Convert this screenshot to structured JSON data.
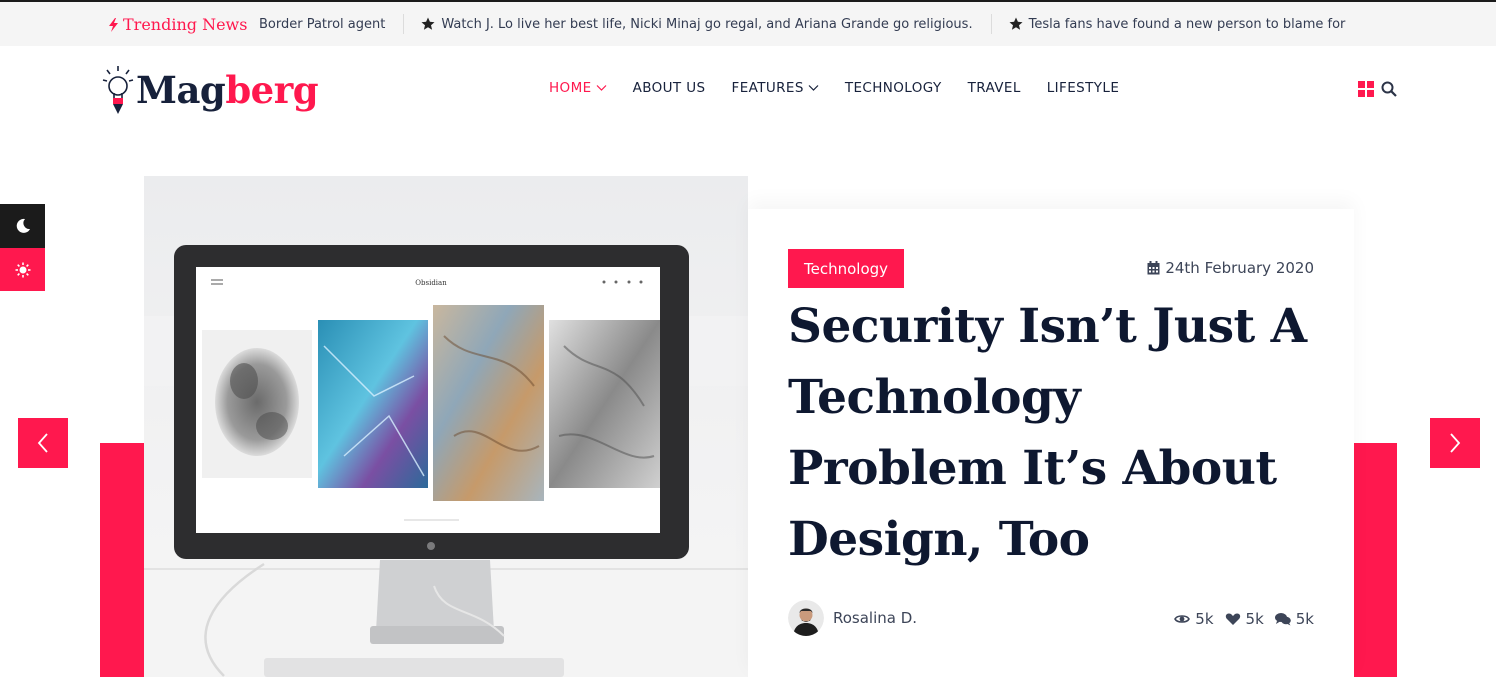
{
  "trending": {
    "label": "Trending News",
    "items": [
      "Border Patrol agent",
      "Watch J. Lo live her best life, Nicki Minaj go regal, and Ariana Grande go religious.",
      "Tesla fans have found a new person to blame for"
    ]
  },
  "logo": {
    "part1": "Mag",
    "part2": "berg"
  },
  "nav": {
    "items": [
      {
        "label": "HOME",
        "dropdown": true,
        "active": true
      },
      {
        "label": "ABOUT US",
        "dropdown": false,
        "active": false
      },
      {
        "label": "FEATURES",
        "dropdown": true,
        "active": false
      },
      {
        "label": "TECHNOLOGY",
        "dropdown": false,
        "active": false
      },
      {
        "label": "TRAVEL",
        "dropdown": false,
        "active": false
      },
      {
        "label": "LIFESTYLE",
        "dropdown": false,
        "active": false
      }
    ]
  },
  "header_icons": [
    "grid-icon",
    "search-icon"
  ],
  "mode_toggle": [
    "moon-icon",
    "sun-icon"
  ],
  "slide": {
    "image_screen_title": "Obsidian",
    "category": "Technology",
    "date": "24th February 2020",
    "title": "Security Isn’t Just A Technology Problem It’s About Design, Too",
    "author": "Rosalina D.",
    "stats": {
      "views": "5k",
      "likes": "5k",
      "comments": "5k"
    }
  },
  "colors": {
    "accent": "#ff184e",
    "dark": "#17213b",
    "topbar_bg": "#f5f5f5"
  }
}
